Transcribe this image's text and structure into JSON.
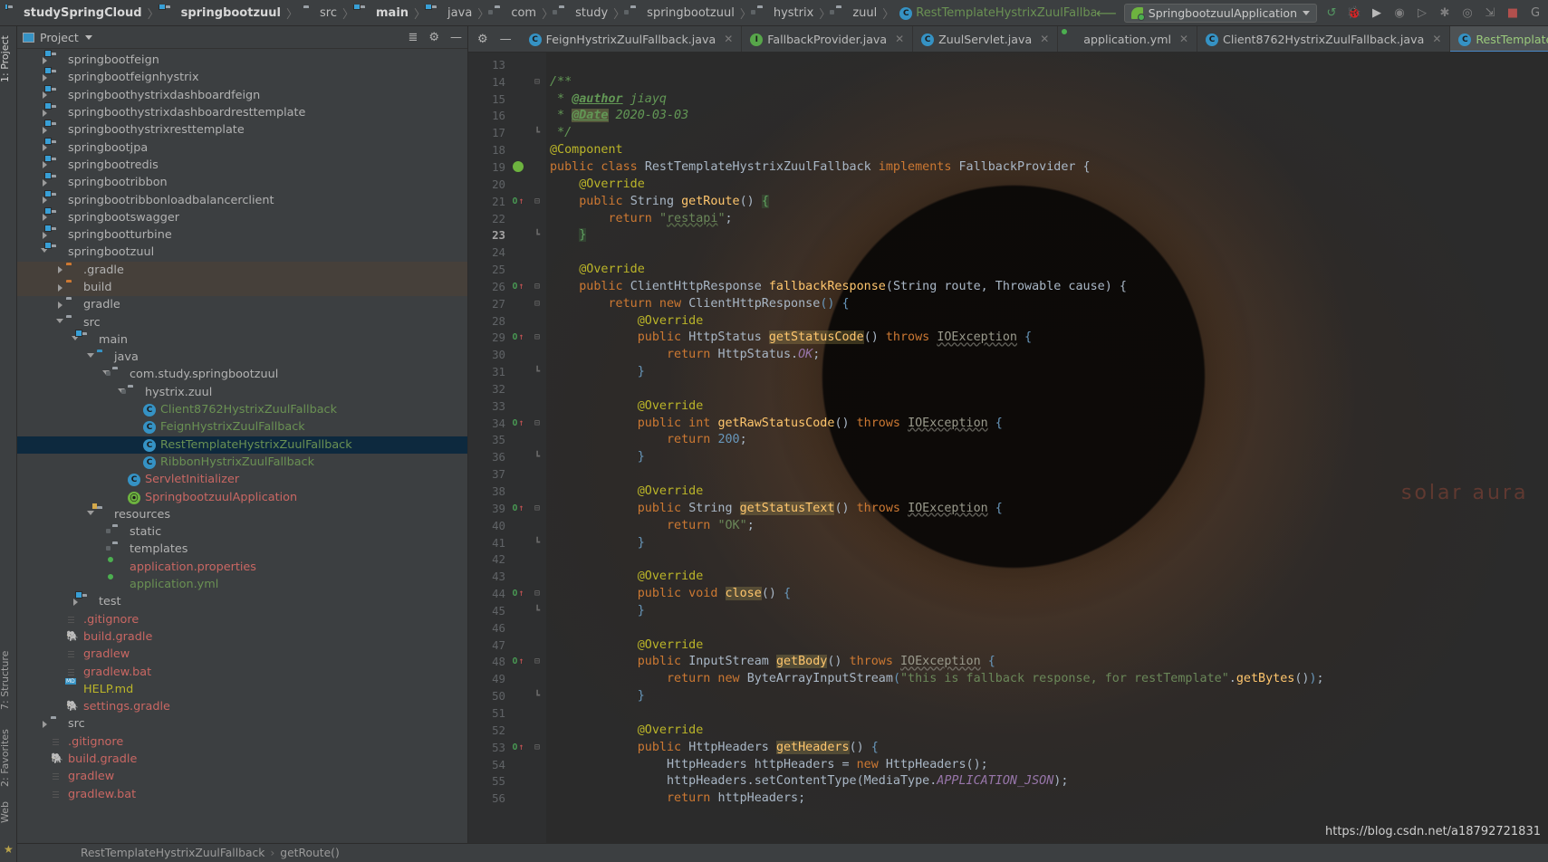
{
  "window": {
    "breadcrumb": [
      {
        "label": "studySpringCloud",
        "icon": "module-folder-icon",
        "style": "bold"
      },
      {
        "label": "springbootzuul",
        "icon": "module-folder-icon",
        "style": "bold"
      },
      {
        "label": "src",
        "icon": "folder-icon",
        "style": "normal"
      },
      {
        "label": "main",
        "icon": "source-folder-icon",
        "style": "bold"
      },
      {
        "label": "java",
        "icon": "source-folder-icon",
        "style": "normal"
      },
      {
        "label": "com",
        "icon": "package-icon",
        "style": "normal"
      },
      {
        "label": "study",
        "icon": "package-icon",
        "style": "normal"
      },
      {
        "label": "springbootzuul",
        "icon": "package-icon",
        "style": "normal"
      },
      {
        "label": "hystrix",
        "icon": "package-icon",
        "style": "normal"
      },
      {
        "label": "zuul",
        "icon": "package-icon",
        "style": "normal"
      },
      {
        "label": "RestTemplateHystrixZuulFallback",
        "icon": "class-icon",
        "style": "class"
      }
    ],
    "run_configuration": "SpringbootzuulApplication",
    "toolbar_icons": [
      "back-arrow-icon",
      "build-icon",
      "debug-icon",
      "run-with-coverage-icon",
      "profile-icon",
      "run-icon",
      "stop-icon",
      "attach-debugger-icon",
      "run-dashboard-icon",
      "stop-red-icon",
      "search-everywhere-icon"
    ]
  },
  "left_strip": {
    "tabs": [
      {
        "label": "1: Project",
        "icon": "project-icon"
      },
      {
        "label": "7: Structure",
        "icon": "structure-icon"
      },
      {
        "label": "2: Favorites",
        "icon": "favorites-star-icon"
      },
      {
        "label": "Web",
        "icon": "web-icon"
      }
    ]
  },
  "project_panel": {
    "title": "Project",
    "header_icons": [
      "collapse-all-icon",
      "settings-gear-icon",
      "hide-icon"
    ],
    "tree": [
      {
        "label": "springbootfeign",
        "depth": 1,
        "icon": "module-folder-icon",
        "arrow": "collapsed",
        "color": "gray"
      },
      {
        "label": "springbootfeignhystrix",
        "depth": 1,
        "icon": "module-folder-icon",
        "arrow": "collapsed",
        "color": "gray"
      },
      {
        "label": "springboothystrixdashboardfeign",
        "depth": 1,
        "icon": "module-folder-icon",
        "arrow": "collapsed",
        "color": "gray"
      },
      {
        "label": "springboothystrixdashboardresttemplate",
        "depth": 1,
        "icon": "module-folder-icon",
        "arrow": "collapsed",
        "color": "gray"
      },
      {
        "label": "springboothystrixresttemplate",
        "depth": 1,
        "icon": "module-folder-icon",
        "arrow": "collapsed",
        "color": "gray"
      },
      {
        "label": "springbootjpa",
        "depth": 1,
        "icon": "module-folder-icon",
        "arrow": "collapsed",
        "color": "gray"
      },
      {
        "label": "springbootredis",
        "depth": 1,
        "icon": "module-folder-icon",
        "arrow": "collapsed",
        "color": "gray"
      },
      {
        "label": "springbootribbon",
        "depth": 1,
        "icon": "module-folder-icon",
        "arrow": "collapsed",
        "color": "gray"
      },
      {
        "label": "springbootribbonloadbalancerclient",
        "depth": 1,
        "icon": "module-folder-icon",
        "arrow": "collapsed",
        "color": "gray"
      },
      {
        "label": "springbootswagger",
        "depth": 1,
        "icon": "module-folder-icon",
        "arrow": "collapsed",
        "color": "gray"
      },
      {
        "label": "springbootturbine",
        "depth": 1,
        "icon": "module-folder-icon",
        "arrow": "collapsed",
        "color": "gray"
      },
      {
        "label": "springbootzuul",
        "depth": 1,
        "icon": "module-folder-icon",
        "arrow": "expanded",
        "color": "gray"
      },
      {
        "label": ".gradle",
        "depth": 2,
        "icon": "excluded-folder-icon",
        "arrow": "collapsed",
        "color": "gray",
        "row": "highlight"
      },
      {
        "label": "build",
        "depth": 2,
        "icon": "excluded-folder-icon",
        "arrow": "collapsed",
        "color": "gray",
        "row": "highlight"
      },
      {
        "label": "gradle",
        "depth": 2,
        "icon": "folder-icon",
        "arrow": "collapsed",
        "color": "gray"
      },
      {
        "label": "src",
        "depth": 2,
        "icon": "folder-icon",
        "arrow": "expanded",
        "color": "gray"
      },
      {
        "label": "main",
        "depth": 3,
        "icon": "source-folder-icon",
        "arrow": "expanded",
        "color": "gray"
      },
      {
        "label": "java",
        "depth": 4,
        "icon": "source-blue-folder-icon",
        "arrow": "expanded",
        "color": "gray"
      },
      {
        "label": "com.study.springbootzuul",
        "depth": 5,
        "icon": "package-icon",
        "arrow": "expanded",
        "color": "gray"
      },
      {
        "label": "hystrix.zuul",
        "depth": 6,
        "icon": "package-icon",
        "arrow": "expanded",
        "color": "gray"
      },
      {
        "label": "Client8762HystrixZuulFallback",
        "depth": 7,
        "icon": "class-icon",
        "arrow": "none",
        "color": "green"
      },
      {
        "label": "FeignHystrixZuulFallback",
        "depth": 7,
        "icon": "class-icon",
        "arrow": "none",
        "color": "green"
      },
      {
        "label": "RestTemplateHystrixZuulFallback",
        "depth": 7,
        "icon": "class-icon",
        "arrow": "none",
        "color": "green",
        "row": "selected"
      },
      {
        "label": "RibbonHystrixZuulFallback",
        "depth": 7,
        "icon": "class-icon",
        "arrow": "none",
        "color": "green"
      },
      {
        "label": "ServletInitializer",
        "depth": 6,
        "icon": "class-icon",
        "arrow": "none",
        "color": "red"
      },
      {
        "label": "SpringbootzuulApplication",
        "depth": 6,
        "icon": "spring-class-icon",
        "arrow": "none",
        "color": "red"
      },
      {
        "label": "resources",
        "depth": 4,
        "icon": "resources-folder-icon",
        "arrow": "expanded",
        "color": "gray"
      },
      {
        "label": "static",
        "depth": 5,
        "icon": "package-icon",
        "arrow": "none",
        "color": "gray"
      },
      {
        "label": "templates",
        "depth": 5,
        "icon": "package-icon",
        "arrow": "none",
        "color": "gray"
      },
      {
        "label": "application.properties",
        "depth": 5,
        "icon": "spring-config-icon",
        "arrow": "none",
        "color": "red"
      },
      {
        "label": "application.yml",
        "depth": 5,
        "icon": "spring-config-icon",
        "arrow": "none",
        "color": "green"
      },
      {
        "label": "test",
        "depth": 3,
        "icon": "test-folder-icon",
        "arrow": "collapsed",
        "color": "gray"
      },
      {
        "label": ".gitignore",
        "depth": 2,
        "icon": "file-icon",
        "arrow": "none",
        "color": "red"
      },
      {
        "label": "build.gradle",
        "depth": 2,
        "icon": "gradle-icon",
        "arrow": "none",
        "color": "red"
      },
      {
        "label": "gradlew",
        "depth": 2,
        "icon": "file-icon",
        "arrow": "none",
        "color": "red"
      },
      {
        "label": "gradlew.bat",
        "depth": 2,
        "icon": "file-icon",
        "arrow": "none",
        "color": "red"
      },
      {
        "label": "HELP.md",
        "depth": 2,
        "icon": "markdown-icon",
        "arrow": "none",
        "color": "yellow"
      },
      {
        "label": "settings.gradle",
        "depth": 2,
        "icon": "gradle-icon",
        "arrow": "none",
        "color": "red"
      },
      {
        "label": "src",
        "depth": 1,
        "icon": "folder-icon",
        "arrow": "collapsed",
        "color": "gray"
      },
      {
        "label": ".gitignore",
        "depth": 1,
        "icon": "file-icon",
        "arrow": "none",
        "color": "red"
      },
      {
        "label": "build.gradle",
        "depth": 1,
        "icon": "gradle-icon",
        "arrow": "none",
        "color": "red"
      },
      {
        "label": "gradlew",
        "depth": 1,
        "icon": "file-icon",
        "arrow": "none",
        "color": "red"
      },
      {
        "label": "gradlew.bat",
        "depth": 1,
        "icon": "file-icon",
        "arrow": "none",
        "color": "red"
      }
    ]
  },
  "editor": {
    "tabs": [
      {
        "label": "FeignHystrixZuulFallback.java",
        "icon": "class-icon",
        "active": false
      },
      {
        "label": "FallbackProvider.java",
        "icon": "interface-icon",
        "active": false
      },
      {
        "label": "ZuulServlet.java",
        "icon": "class-icon",
        "active": false
      },
      {
        "label": "application.yml",
        "icon": "spring-config-icon",
        "active": false
      },
      {
        "label": "Client8762HystrixZuulFallback.java",
        "icon": "class-icon",
        "active": false
      },
      {
        "label": "RestTemplateHystrixZuulFallback.java",
        "icon": "class-icon",
        "active": true
      }
    ],
    "first_line_number": 13,
    "current_line": 23,
    "watermark": "solar aura",
    "lines": [
      {
        "n": 13,
        "text": ""
      },
      {
        "n": 14,
        "fold": "minus",
        "text": "/**",
        "cls": "cmt",
        "indent": 0
      },
      {
        "n": 15,
        "text": " * @author jiayq",
        "kind": "javadoc-author"
      },
      {
        "n": 16,
        "text": " * @Date 2020-03-03",
        "kind": "javadoc-date"
      },
      {
        "n": 17,
        "fold": "end",
        "text": " */",
        "cls": "cmt"
      },
      {
        "n": 18,
        "text": "@Component",
        "kind": "annotation"
      },
      {
        "n": 19,
        "gutter": "spring",
        "text": "public class RestTemplateHystrixZuulFallback implements FallbackProvider {",
        "kind": "classdecl"
      },
      {
        "n": 20,
        "text": "    @Override",
        "kind": "annotation"
      },
      {
        "n": 21,
        "gutter": "override",
        "fold": "minus",
        "text": "    public String getRoute() {",
        "kind": "method-getroute"
      },
      {
        "n": 22,
        "text": "        return \"restapi\";",
        "kind": "return-restapi"
      },
      {
        "n": 23,
        "fold": "end",
        "text": "    }",
        "kind": "closebrace-green",
        "current": true
      },
      {
        "n": 24,
        "text": ""
      },
      {
        "n": 25,
        "text": "    @Override",
        "kind": "annotation"
      },
      {
        "n": 26,
        "gutter": "override",
        "fold": "minus",
        "text": "    public ClientHttpResponse fallbackResponse(String route, Throwable cause) {",
        "kind": "method-fallback"
      },
      {
        "n": 27,
        "fold": "minus",
        "text": "        return new ClientHttpResponse() {",
        "kind": "return-anon"
      },
      {
        "n": 28,
        "text": "            @Override",
        "kind": "annotation"
      },
      {
        "n": 29,
        "gutter": "override",
        "fold": "minus",
        "text": "            public HttpStatus getStatusCode() throws IOException {",
        "kind": "m-getstatuscode"
      },
      {
        "n": 30,
        "text": "                return HttpStatus.OK;",
        "kind": "return-httpstatus"
      },
      {
        "n": 31,
        "fold": "end",
        "text": "            }",
        "kind": "closebrace-blue"
      },
      {
        "n": 32,
        "text": ""
      },
      {
        "n": 33,
        "text": "            @Override",
        "kind": "annotation"
      },
      {
        "n": 34,
        "gutter": "override",
        "fold": "minus",
        "text": "            public int getRawStatusCode() throws IOException {",
        "kind": "m-getrawstatuscode"
      },
      {
        "n": 35,
        "text": "                return 200;",
        "kind": "return-200"
      },
      {
        "n": 36,
        "fold": "end",
        "text": "            }",
        "kind": "closebrace-blue"
      },
      {
        "n": 37,
        "text": ""
      },
      {
        "n": 38,
        "text": "            @Override",
        "kind": "annotation"
      },
      {
        "n": 39,
        "gutter": "override",
        "fold": "minus",
        "text": "            public String getStatusText() throws IOException {",
        "kind": "m-getstatustext"
      },
      {
        "n": 40,
        "text": "                return \"OK\";",
        "kind": "return-ok"
      },
      {
        "n": 41,
        "fold": "end",
        "text": "            }",
        "kind": "closebrace-blue"
      },
      {
        "n": 42,
        "text": ""
      },
      {
        "n": 43,
        "text": "            @Override",
        "kind": "annotation"
      },
      {
        "n": 44,
        "gutter": "override",
        "fold": "minus",
        "text": "            public void close() {",
        "kind": "m-close"
      },
      {
        "n": 45,
        "fold": "end",
        "text": "            }",
        "kind": "closebrace-blue"
      },
      {
        "n": 46,
        "text": ""
      },
      {
        "n": 47,
        "text": "            @Override",
        "kind": "annotation"
      },
      {
        "n": 48,
        "gutter": "override",
        "fold": "minus",
        "text": "            public InputStream getBody() throws IOException {",
        "kind": "m-getbody"
      },
      {
        "n": 49,
        "text": "                return new ByteArrayInputStream(\"this is fallback response, for restTemplate\".getBytes());",
        "kind": "return-bytearray"
      },
      {
        "n": 50,
        "fold": "end",
        "text": "            }",
        "kind": "closebrace-blue"
      },
      {
        "n": 51,
        "text": ""
      },
      {
        "n": 52,
        "text": "            @Override",
        "kind": "annotation"
      },
      {
        "n": 53,
        "gutter": "override",
        "fold": "minus",
        "text": "            public HttpHeaders getHeaders() {",
        "kind": "m-getheaders"
      },
      {
        "n": 54,
        "text": "                HttpHeaders httpHeaders = new HttpHeaders();",
        "kind": "l-httpheaders"
      },
      {
        "n": 55,
        "text": "                httpHeaders.setContentType(MediaType.APPLICATION_JSON);",
        "kind": "l-setcontenttype"
      },
      {
        "n": 56,
        "text": "                return httpHeaders;",
        "kind": "l-returnheaders"
      }
    ]
  },
  "status_bar": {
    "breadcrumb": [
      "RestTemplateHystrixZuulFallback",
      "getRoute()"
    ],
    "separator": "›",
    "url_stamp": "https://blog.csdn.net/a18792721831"
  },
  "colors": {
    "background": "#3c3f41",
    "editor_background": "#2b2b2b",
    "selection": "#0d293e",
    "accent_blue": "#3592c4",
    "keyword_orange": "#cc7832",
    "string_green": "#6a8759",
    "annotation_yellow": "#bbb529",
    "method_yellow": "#ffc66d",
    "number_blue": "#6897bb",
    "class_green": "#6a9153",
    "file_red": "#c96763"
  }
}
